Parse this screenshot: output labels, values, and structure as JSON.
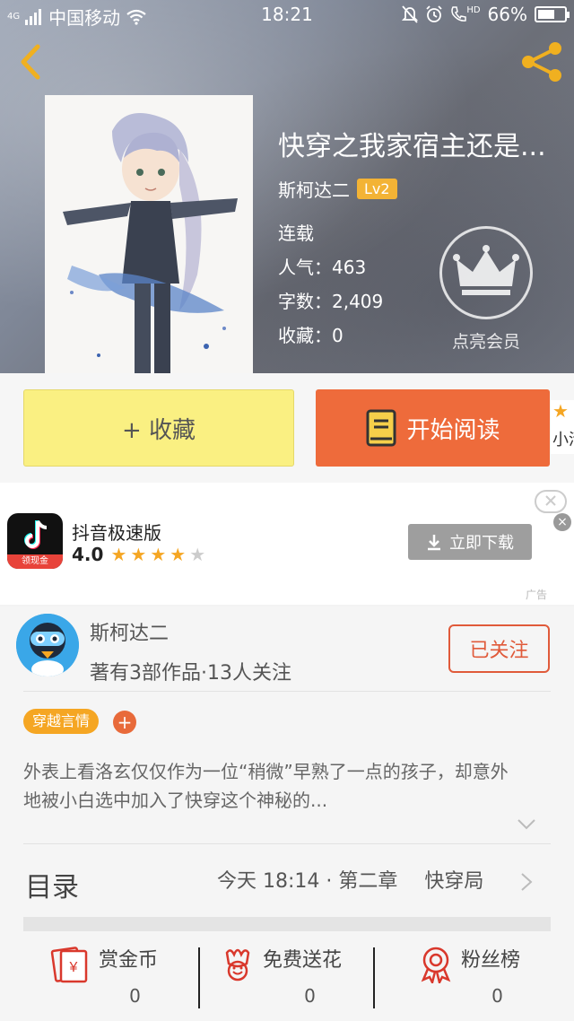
{
  "statusbar": {
    "network": "4G",
    "carrier": "中国移动",
    "time": "18:21",
    "battery": "66%",
    "battery_level": 0.66,
    "hd": "HD"
  },
  "book": {
    "title": "快穿之我家宿主还是...",
    "author": "斯柯达二",
    "level": "Lv2",
    "status": "连载",
    "popularity_label": "人气：",
    "popularity": "463",
    "words_label": "字数：",
    "words": "2,409",
    "favorites_label": "收藏：",
    "favorites": "0"
  },
  "vip": {
    "label": "点亮会员"
  },
  "actions": {
    "collect": "+ 收藏",
    "read": "开始阅读",
    "peek_text": "小清"
  },
  "ad": {
    "app_name": "抖音极速版",
    "rating": "4.0",
    "rating_stars": 4,
    "badge": "领现金",
    "download": "立即下载",
    "tag": "广告"
  },
  "author": {
    "name": "斯柯达二",
    "summary": "著有3部作品·13人关注",
    "follow": "已关注"
  },
  "tags": {
    "genre": "穿越言情",
    "add": "+"
  },
  "description": "外表上看洛玄仅仅作为一位“稍微”早熟了一点的孩子，却意外地被小白选中加入了快穿这个神秘的...",
  "toc": {
    "label": "目录",
    "updated": "今天 18:14 · 第二章",
    "chapter_title": "快穿局"
  },
  "stats": [
    {
      "label": "赏金币",
      "value": "0",
      "icon": "red-envelope-icon"
    },
    {
      "label": "免费送花",
      "value": "0",
      "icon": "flower-icon"
    },
    {
      "label": "粉丝榜",
      "value": "0",
      "icon": "medal-icon"
    }
  ],
  "colors": {
    "accent_orange": "#ee6b3b",
    "collect_yellow": "#faf082",
    "tag_orange": "#f5a623",
    "follow_red": "#e05a3a",
    "level_badge": "#f3b335"
  }
}
